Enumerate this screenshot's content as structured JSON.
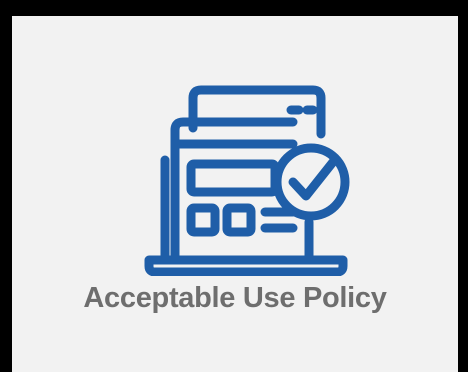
{
  "tile": {
    "label": "Acceptable Use Policy",
    "icon": "laptop-checkmark-icon",
    "accent_color": "#1f5ea8",
    "label_color": "#6e6e6e",
    "background": "#f2f2f2"
  }
}
